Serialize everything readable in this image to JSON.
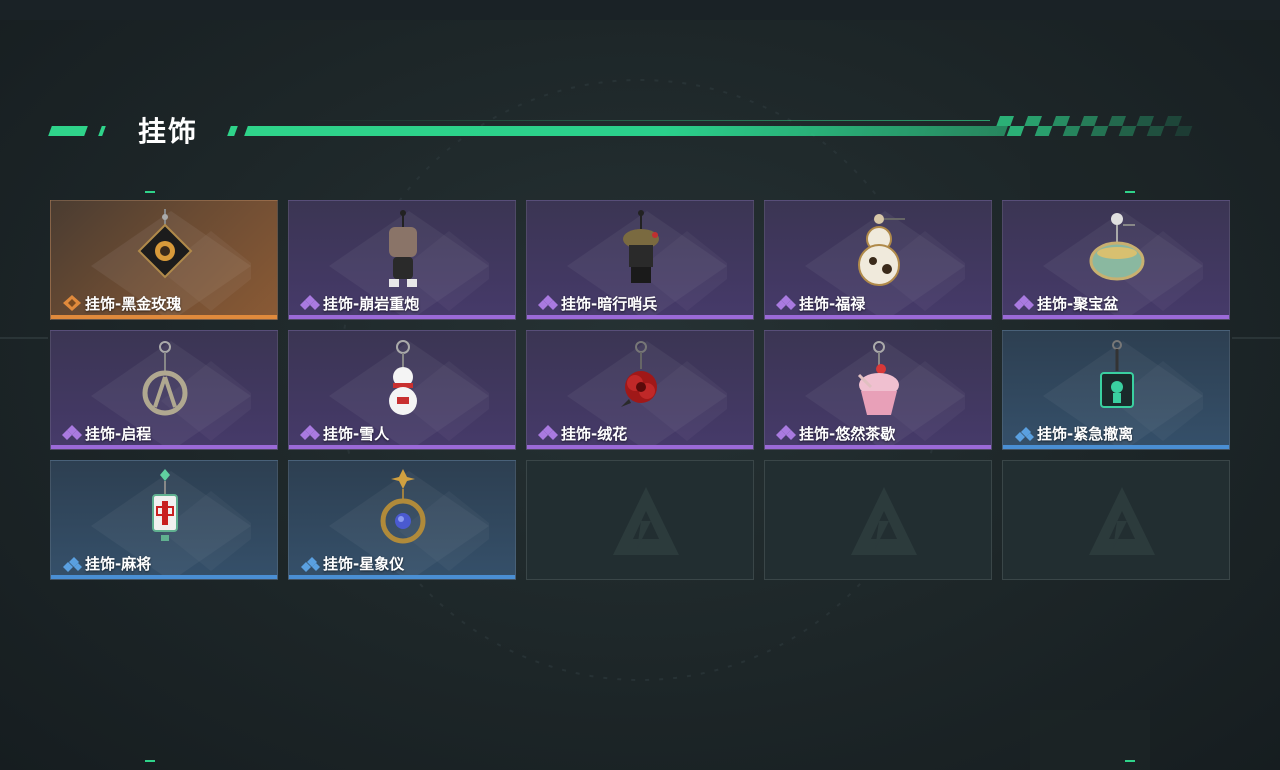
{
  "header": {
    "title": "挂饰"
  },
  "colors": {
    "accent": "#2fd38a",
    "rarity_orange": "#e08a3c",
    "rarity_purple": "#9b6ad8",
    "rarity_blue": "#4a8fd4"
  },
  "grid": {
    "items": [
      {
        "name": "挂饰-黑金玫瑰",
        "rarity": "orange",
        "icon": "black-gold-rose-charm-icon"
      },
      {
        "name": "挂饰-崩岩重炮",
        "rarity": "purple",
        "icon": "rock-cannon-charm-icon"
      },
      {
        "name": "挂饰-暗行哨兵",
        "rarity": "purple",
        "icon": "dark-sentinel-charm-icon"
      },
      {
        "name": "挂饰-福禄",
        "rarity": "purple",
        "icon": "gourd-charm-icon"
      },
      {
        "name": "挂饰-聚宝盆",
        "rarity": "purple",
        "icon": "treasure-bowl-charm-icon"
      },
      {
        "name": "挂饰-启程",
        "rarity": "purple",
        "icon": "journey-medal-charm-icon"
      },
      {
        "name": "挂饰-雪人",
        "rarity": "purple",
        "icon": "snowman-charm-icon"
      },
      {
        "name": "挂饰-绒花",
        "rarity": "purple",
        "icon": "velvet-flower-charm-icon"
      },
      {
        "name": "挂饰-悠然茶歇",
        "rarity": "purple",
        "icon": "cupcake-charm-icon"
      },
      {
        "name": "挂饰-紧急撤离",
        "rarity": "blue",
        "icon": "emergency-evac-charm-icon"
      },
      {
        "name": "挂饰-麻将",
        "rarity": "blue",
        "icon": "mahjong-tile-charm-icon"
      },
      {
        "name": "挂饰-星象仪",
        "rarity": "blue",
        "icon": "astrolabe-charm-icon"
      }
    ],
    "empty_slots": 3
  }
}
